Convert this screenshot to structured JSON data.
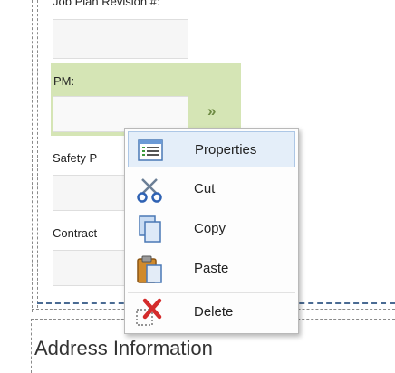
{
  "form": {
    "job_plan_revision_label": "Job Plan Revision #:",
    "pm_label": "PM:",
    "pm_lookup_glyph": "»",
    "safety_plan_label": "Safety P",
    "contract_label": "Contract",
    "section_title": "Address Information"
  },
  "context_menu": {
    "items": [
      {
        "label": "Properties",
        "icon": "properties-icon",
        "selected": true
      },
      {
        "label": "Cut",
        "icon": "scissors-icon",
        "selected": false
      },
      {
        "label": "Copy",
        "icon": "copy-icon",
        "selected": false
      },
      {
        "label": "Paste",
        "icon": "paste-icon",
        "selected": false
      },
      {
        "label": "Delete",
        "icon": "delete-icon",
        "selected": false
      }
    ]
  },
  "colors": {
    "pm_highlight": "#d5e5b5",
    "menu_selected": "#e4eef9",
    "guide_blue": "#4a6b93"
  }
}
